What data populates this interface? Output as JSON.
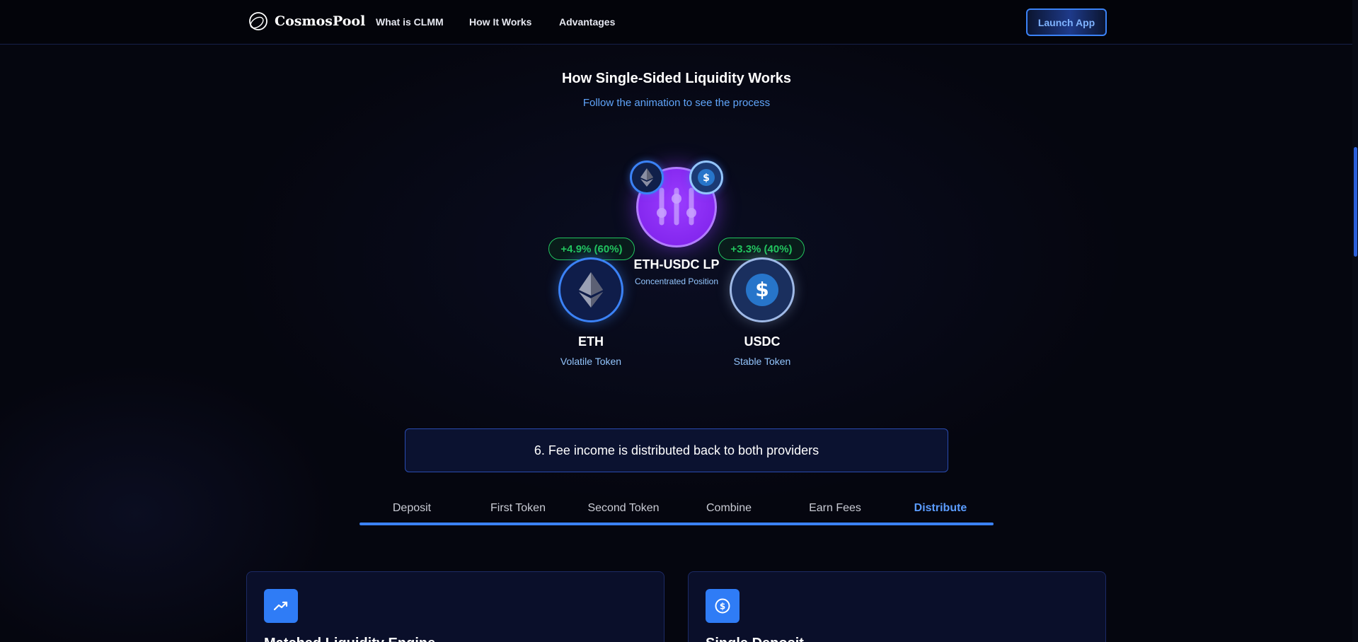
{
  "header": {
    "logo_text": "CosmosPool",
    "nav": [
      "What is CLMM",
      "How It Works",
      "Advantages"
    ],
    "launch_label": "Launch App"
  },
  "section": {
    "title": "How Single-Sided Liquidity Works",
    "subtitle": "Follow the animation to see the process"
  },
  "diagram": {
    "lp_label": "ETH-USDC LP",
    "lp_sub": "Concentrated Position",
    "eth": {
      "name": "ETH",
      "sub": "Volatile Token",
      "badge": "+4.9% (60%)"
    },
    "usdc": {
      "name": "USDC",
      "sub": "Stable Token",
      "badge": "+3.3% (40%)"
    }
  },
  "step_text": "6. Fee income is distributed back to both providers",
  "tabs": [
    "Deposit",
    "First Token",
    "Second Token",
    "Combine",
    "Earn Fees",
    "Distribute"
  ],
  "active_tab": "Distribute",
  "cards": [
    {
      "icon": "trending-up-icon",
      "title": "Matched Liquidity Engine"
    },
    {
      "icon": "dollar-circle-icon",
      "title": "Single Deposit"
    }
  ],
  "colors": {
    "accent": "#3b82f6",
    "lp_purple": "#8b2cf5",
    "positive": "#22c55e",
    "background": "#05060f"
  }
}
